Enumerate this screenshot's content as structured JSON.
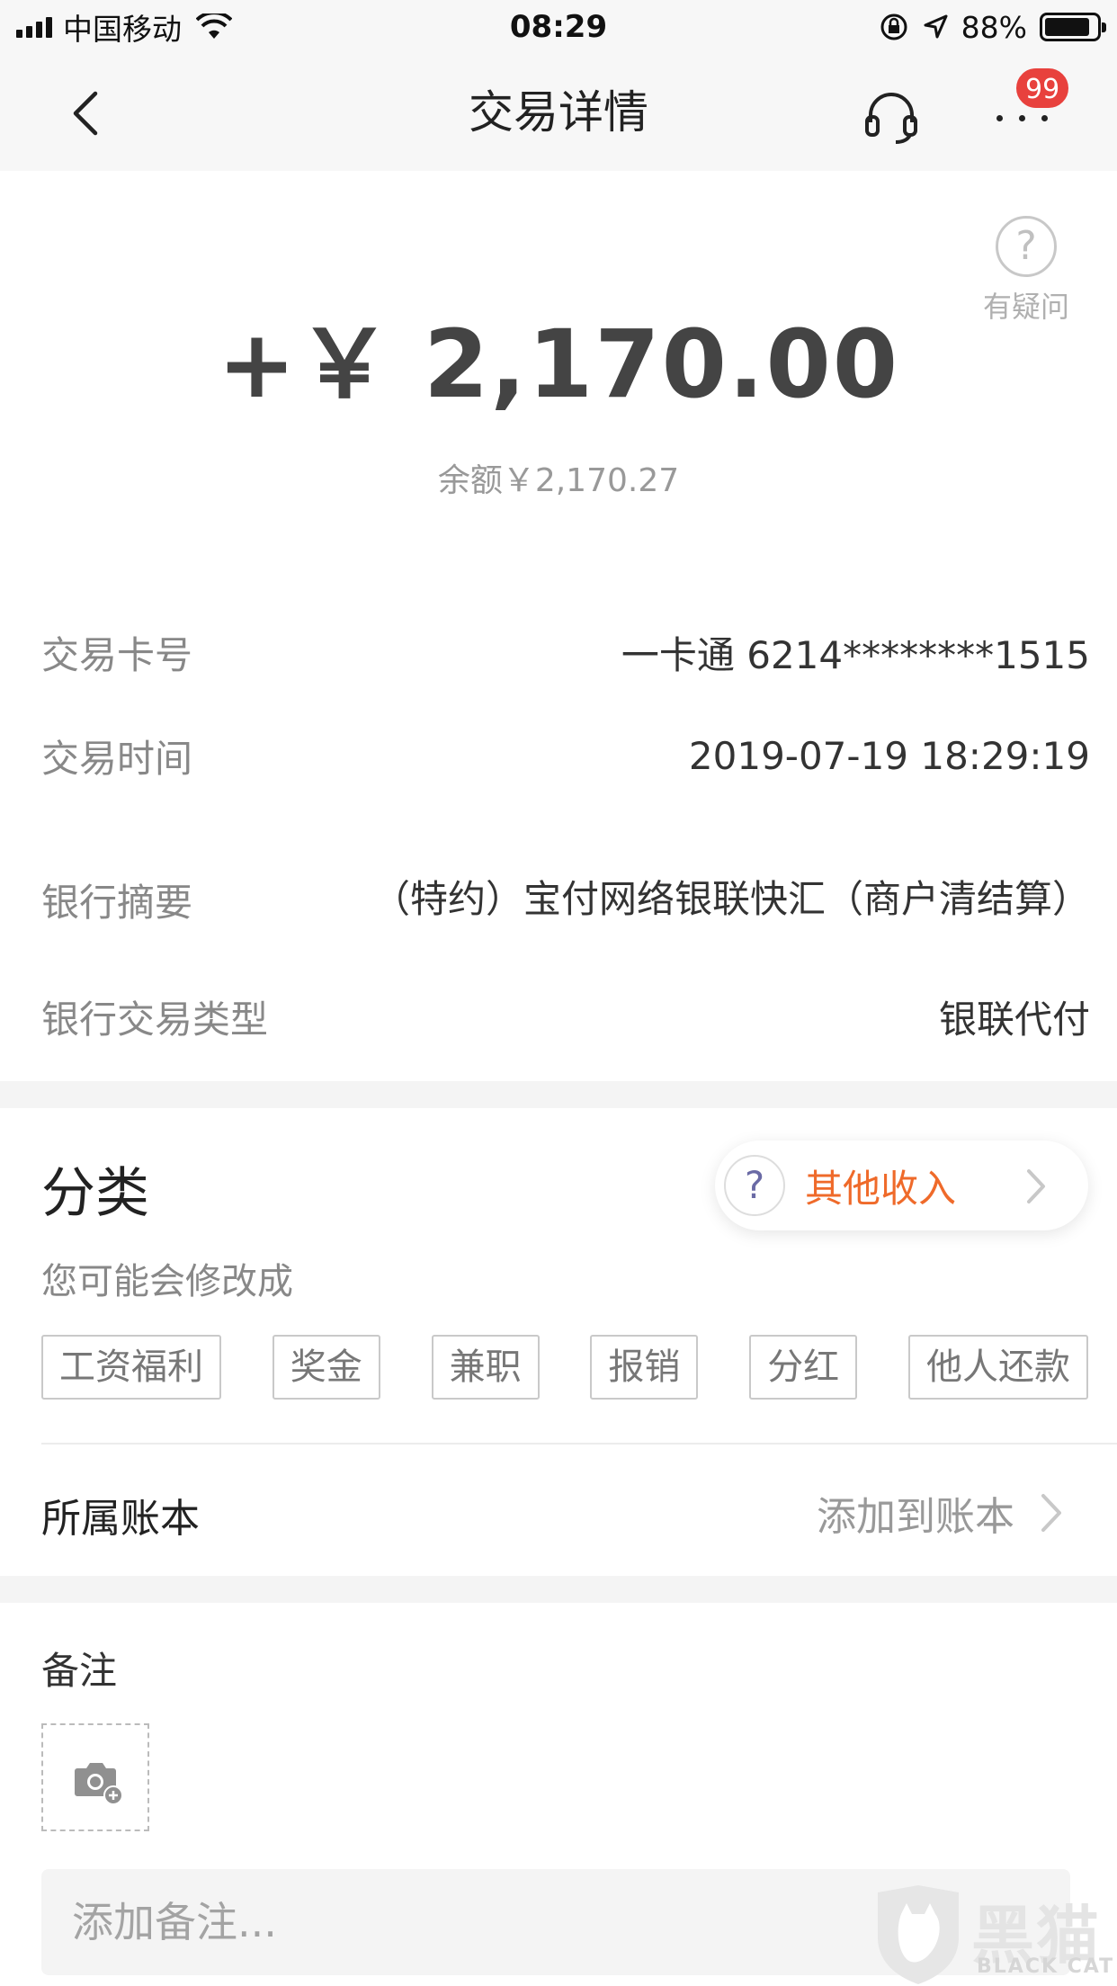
{
  "status_bar": {
    "carrier": "中国移动",
    "time": "08:29",
    "battery_pct": "88%",
    "battery_level": 0.88
  },
  "nav": {
    "title": "交易详情",
    "badge": "99",
    "icons": [
      "back-chevron-icon",
      "headset-icon",
      "more-icon"
    ]
  },
  "summary": {
    "help_label": "有疑问",
    "amount_prefix": "+￥",
    "amount": "2,170.00",
    "balance": "余额￥2,170.27"
  },
  "details": [
    {
      "label": "交易卡号",
      "value": "一卡通 6214********1515"
    },
    {
      "label": "交易时间",
      "value": "2019-07-19 18:29:19"
    },
    {
      "label": "银行摘要",
      "value": "（特约）宝付网络银联快汇（商户清结算）"
    },
    {
      "label": "银行交易类型",
      "value": "银联代付"
    }
  ],
  "category": {
    "title": "分类",
    "current": "其他收入",
    "hint": "您可能会修改成",
    "tags": [
      "工资福利",
      "奖金",
      "兼职",
      "报销",
      "分红",
      "他人还款"
    ]
  },
  "account_book": {
    "label": "所属账本",
    "action": "添加到账本"
  },
  "note": {
    "title": "备注",
    "placeholder": "添加备注..."
  },
  "watermark": {
    "cn": "黑猫",
    "en": "BLACK CAT"
  },
  "colors": {
    "accent_orange": "#ef6a2a",
    "badge_red": "#e8413d",
    "background": "#f4f4f4"
  }
}
